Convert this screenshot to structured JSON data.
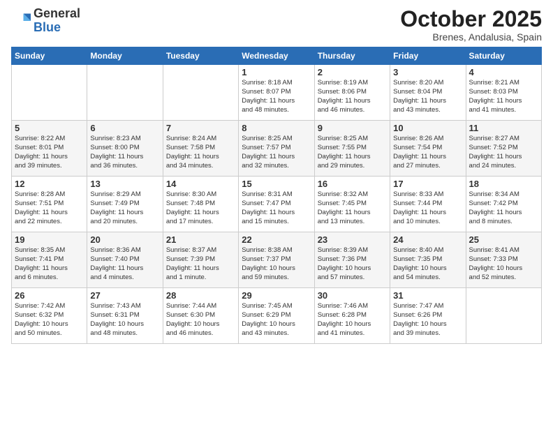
{
  "logo": {
    "general": "General",
    "blue": "Blue"
  },
  "header": {
    "month": "October 2025",
    "location": "Brenes, Andalusia, Spain"
  },
  "days_of_week": [
    "Sunday",
    "Monday",
    "Tuesday",
    "Wednesday",
    "Thursday",
    "Friday",
    "Saturday"
  ],
  "weeks": [
    [
      {
        "day": "",
        "info": ""
      },
      {
        "day": "",
        "info": ""
      },
      {
        "day": "",
        "info": ""
      },
      {
        "day": "1",
        "info": "Sunrise: 8:18 AM\nSunset: 8:07 PM\nDaylight: 11 hours\nand 48 minutes."
      },
      {
        "day": "2",
        "info": "Sunrise: 8:19 AM\nSunset: 8:06 PM\nDaylight: 11 hours\nand 46 minutes."
      },
      {
        "day": "3",
        "info": "Sunrise: 8:20 AM\nSunset: 8:04 PM\nDaylight: 11 hours\nand 43 minutes."
      },
      {
        "day": "4",
        "info": "Sunrise: 8:21 AM\nSunset: 8:03 PM\nDaylight: 11 hours\nand 41 minutes."
      }
    ],
    [
      {
        "day": "5",
        "info": "Sunrise: 8:22 AM\nSunset: 8:01 PM\nDaylight: 11 hours\nand 39 minutes."
      },
      {
        "day": "6",
        "info": "Sunrise: 8:23 AM\nSunset: 8:00 PM\nDaylight: 11 hours\nand 36 minutes."
      },
      {
        "day": "7",
        "info": "Sunrise: 8:24 AM\nSunset: 7:58 PM\nDaylight: 11 hours\nand 34 minutes."
      },
      {
        "day": "8",
        "info": "Sunrise: 8:25 AM\nSunset: 7:57 PM\nDaylight: 11 hours\nand 32 minutes."
      },
      {
        "day": "9",
        "info": "Sunrise: 8:25 AM\nSunset: 7:55 PM\nDaylight: 11 hours\nand 29 minutes."
      },
      {
        "day": "10",
        "info": "Sunrise: 8:26 AM\nSunset: 7:54 PM\nDaylight: 11 hours\nand 27 minutes."
      },
      {
        "day": "11",
        "info": "Sunrise: 8:27 AM\nSunset: 7:52 PM\nDaylight: 11 hours\nand 24 minutes."
      }
    ],
    [
      {
        "day": "12",
        "info": "Sunrise: 8:28 AM\nSunset: 7:51 PM\nDaylight: 11 hours\nand 22 minutes."
      },
      {
        "day": "13",
        "info": "Sunrise: 8:29 AM\nSunset: 7:49 PM\nDaylight: 11 hours\nand 20 minutes."
      },
      {
        "day": "14",
        "info": "Sunrise: 8:30 AM\nSunset: 7:48 PM\nDaylight: 11 hours\nand 17 minutes."
      },
      {
        "day": "15",
        "info": "Sunrise: 8:31 AM\nSunset: 7:47 PM\nDaylight: 11 hours\nand 15 minutes."
      },
      {
        "day": "16",
        "info": "Sunrise: 8:32 AM\nSunset: 7:45 PM\nDaylight: 11 hours\nand 13 minutes."
      },
      {
        "day": "17",
        "info": "Sunrise: 8:33 AM\nSunset: 7:44 PM\nDaylight: 11 hours\nand 10 minutes."
      },
      {
        "day": "18",
        "info": "Sunrise: 8:34 AM\nSunset: 7:42 PM\nDaylight: 11 hours\nand 8 minutes."
      }
    ],
    [
      {
        "day": "19",
        "info": "Sunrise: 8:35 AM\nSunset: 7:41 PM\nDaylight: 11 hours\nand 6 minutes."
      },
      {
        "day": "20",
        "info": "Sunrise: 8:36 AM\nSunset: 7:40 PM\nDaylight: 11 hours\nand 4 minutes."
      },
      {
        "day": "21",
        "info": "Sunrise: 8:37 AM\nSunset: 7:39 PM\nDaylight: 11 hours\nand 1 minute."
      },
      {
        "day": "22",
        "info": "Sunrise: 8:38 AM\nSunset: 7:37 PM\nDaylight: 10 hours\nand 59 minutes."
      },
      {
        "day": "23",
        "info": "Sunrise: 8:39 AM\nSunset: 7:36 PM\nDaylight: 10 hours\nand 57 minutes."
      },
      {
        "day": "24",
        "info": "Sunrise: 8:40 AM\nSunset: 7:35 PM\nDaylight: 10 hours\nand 54 minutes."
      },
      {
        "day": "25",
        "info": "Sunrise: 8:41 AM\nSunset: 7:33 PM\nDaylight: 10 hours\nand 52 minutes."
      }
    ],
    [
      {
        "day": "26",
        "info": "Sunrise: 7:42 AM\nSunset: 6:32 PM\nDaylight: 10 hours\nand 50 minutes."
      },
      {
        "day": "27",
        "info": "Sunrise: 7:43 AM\nSunset: 6:31 PM\nDaylight: 10 hours\nand 48 minutes."
      },
      {
        "day": "28",
        "info": "Sunrise: 7:44 AM\nSunset: 6:30 PM\nDaylight: 10 hours\nand 46 minutes."
      },
      {
        "day": "29",
        "info": "Sunrise: 7:45 AM\nSunset: 6:29 PM\nDaylight: 10 hours\nand 43 minutes."
      },
      {
        "day": "30",
        "info": "Sunrise: 7:46 AM\nSunset: 6:28 PM\nDaylight: 10 hours\nand 41 minutes."
      },
      {
        "day": "31",
        "info": "Sunrise: 7:47 AM\nSunset: 6:26 PM\nDaylight: 10 hours\nand 39 minutes."
      },
      {
        "day": "",
        "info": ""
      }
    ]
  ]
}
